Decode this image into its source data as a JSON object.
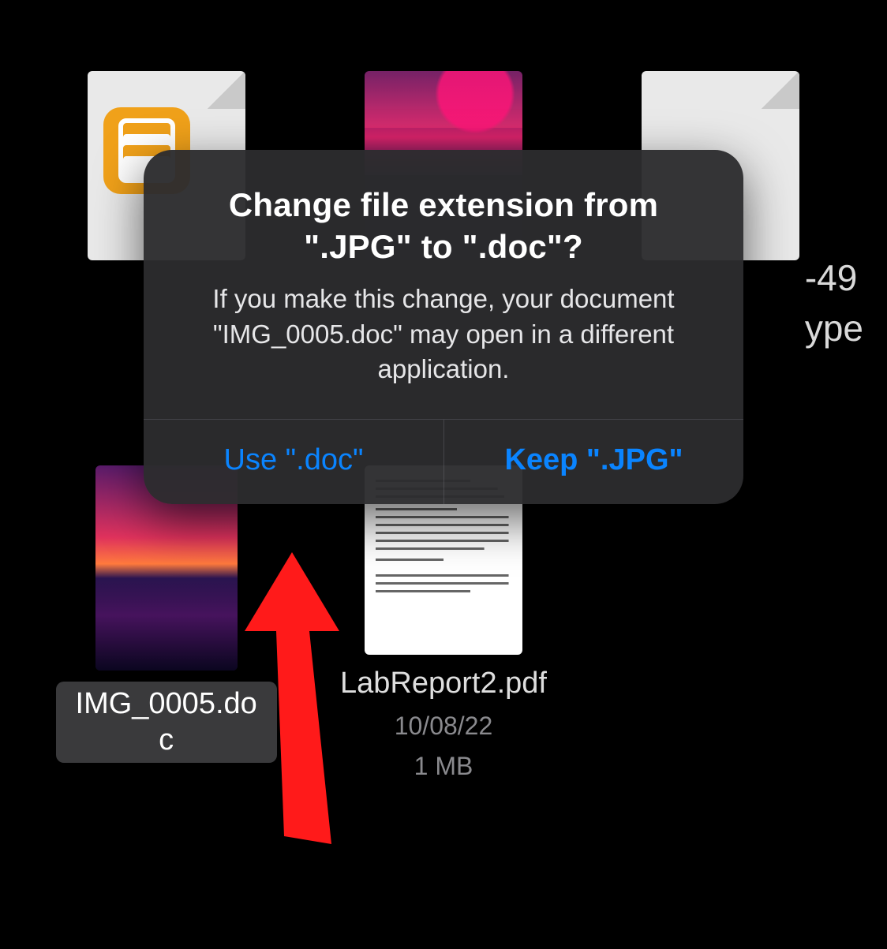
{
  "alert": {
    "title": "Change file extension from \".JPG\" to \".doc\"?",
    "message": "If you make this change, your document \"IMG_0005.doc\" may open in a different application.",
    "confirm_label": "Use \".doc\"",
    "cancel_label": "Keep \".JPG\""
  },
  "files": {
    "item0_name": "IMG_0005.doc",
    "item1_name": "LabReport2.pdf",
    "item1_date": "10/08/22",
    "item1_size": "1 MB"
  },
  "peek": {
    "line1": "-49",
    "line2": "ype"
  },
  "annotation": {
    "arrow_color": "#ff1a1a"
  }
}
